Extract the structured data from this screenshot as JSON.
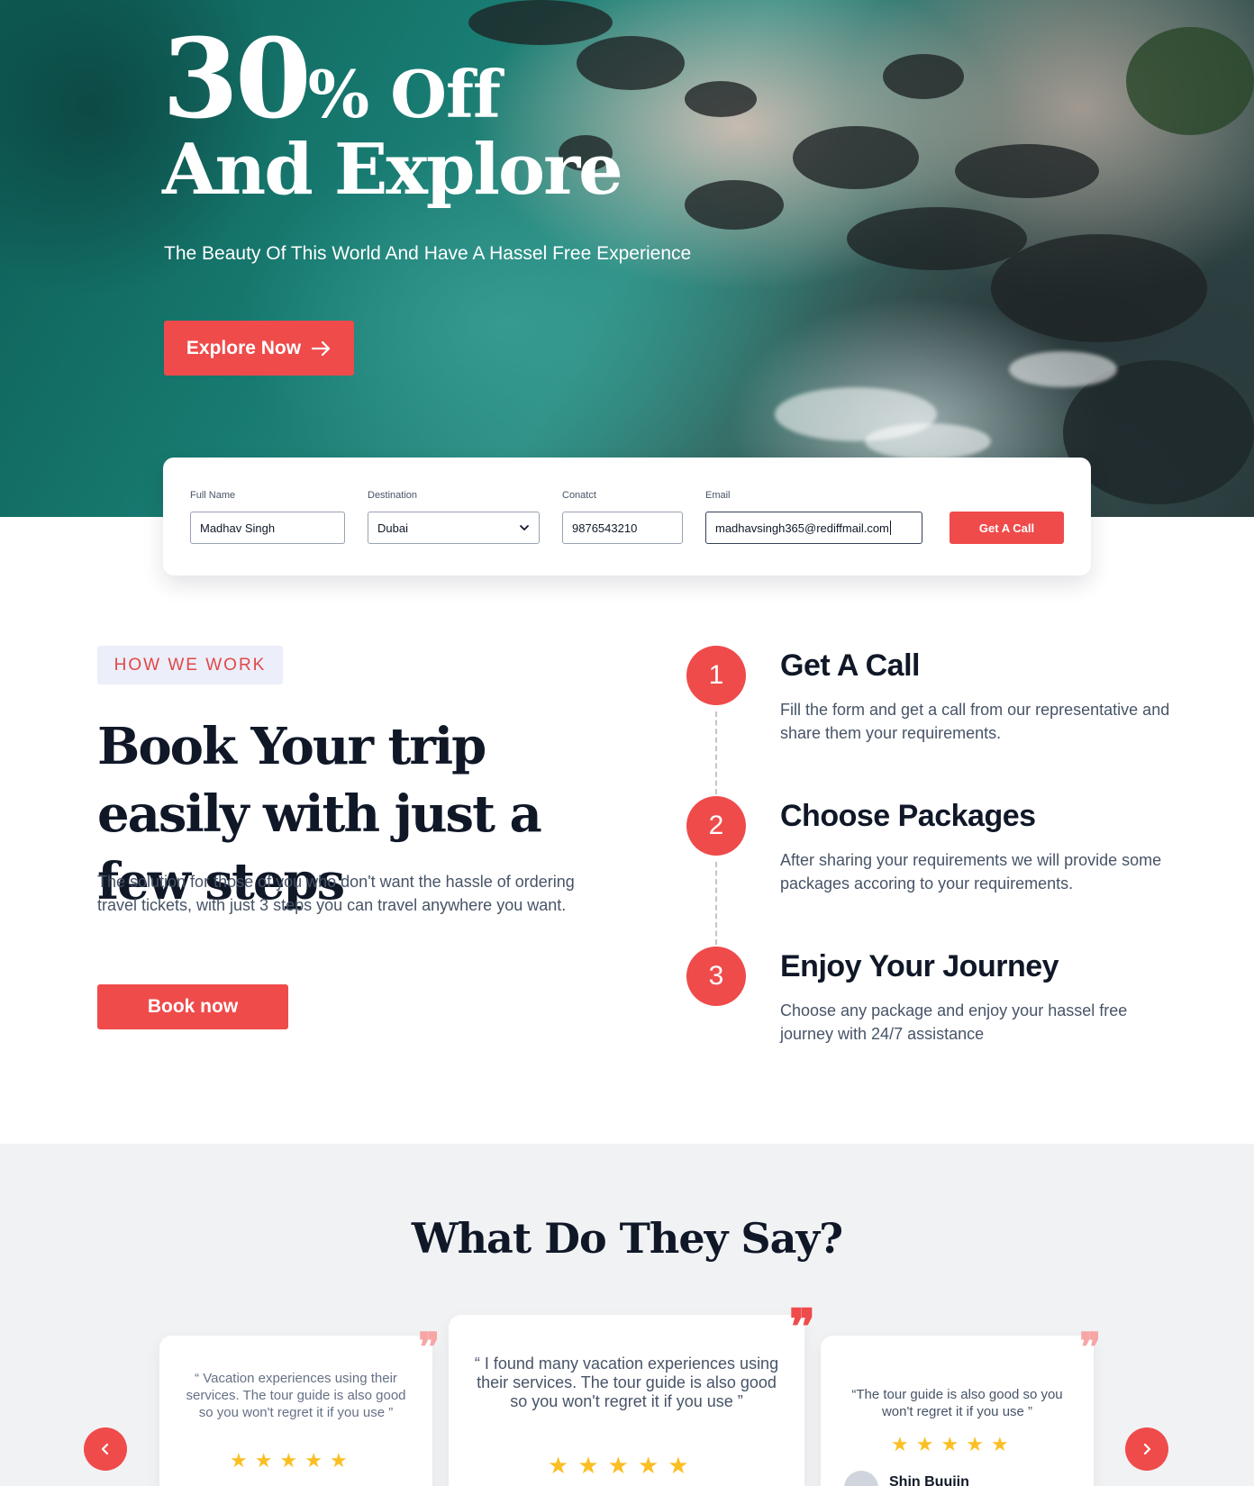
{
  "hero": {
    "offer_number": "30",
    "offer_rest": "% Off",
    "line2": "And Explore",
    "subtitle": "The Beauty Of This World And Have A Hassel Free Experience",
    "explore_label": "Explore Now",
    "arrow_icon": "arrow-right-icon"
  },
  "form": {
    "fields": [
      {
        "label": "Full Name",
        "value": "Madhav Singh"
      },
      {
        "label": "Destination",
        "value": "Dubai"
      },
      {
        "label": "Conatct",
        "value": "9876543210"
      },
      {
        "label": "Email",
        "value": "madhavsingh365@rediffmail.com"
      }
    ],
    "submit_label": "Get A Call",
    "dropdown_icon": "chevron-down-icon"
  },
  "how_we_work": {
    "tag": "HOW WE WORK",
    "title": "Book Your trip easily with just a few steps",
    "description": "The solution for those of you who don't want the hassle of ordering travel tickets, with just 3 steps you can travel anywhere you want.",
    "book_label": "Book now",
    "steps": [
      {
        "number": "1",
        "title": "Get A Call",
        "description": "Fill the form and get a call from our representative and share them your requirements."
      },
      {
        "number": "2",
        "title": "Choose Packages",
        "description": "After sharing your requirements we will provide some packages accoring to your requirements."
      },
      {
        "number": "3",
        "title": "Enjoy Your Journey",
        "description": "Choose any package and enjoy your hassel free journey with 24/7 assistance"
      }
    ]
  },
  "testimonials": {
    "title": "What Do They Say?",
    "cards": [
      {
        "text": "“ Vacation experiences using their services. The tour guide is also good so you won't regret it if you use ”",
        "rating": 5
      },
      {
        "text": "“ I found many vacation experiences using their services. The tour guide is also good so you won't regret it if you use ”",
        "rating": 5
      },
      {
        "text": "“The tour guide is also good so you won't regret it if you use ”",
        "rating": 5,
        "author": "Shin Buujin"
      }
    ],
    "prev_icon": "chevron-left-icon",
    "next_icon": "chevron-right-icon",
    "star_icon": "star-icon",
    "quote_icon": "quote-icon"
  },
  "colors": {
    "accent": "#ef4b4b",
    "tag_bg": "#eceef9",
    "text_dark": "#101828",
    "text_muted": "#475467",
    "star": "#fbbf24",
    "section_bg": "#f1f2f4"
  }
}
